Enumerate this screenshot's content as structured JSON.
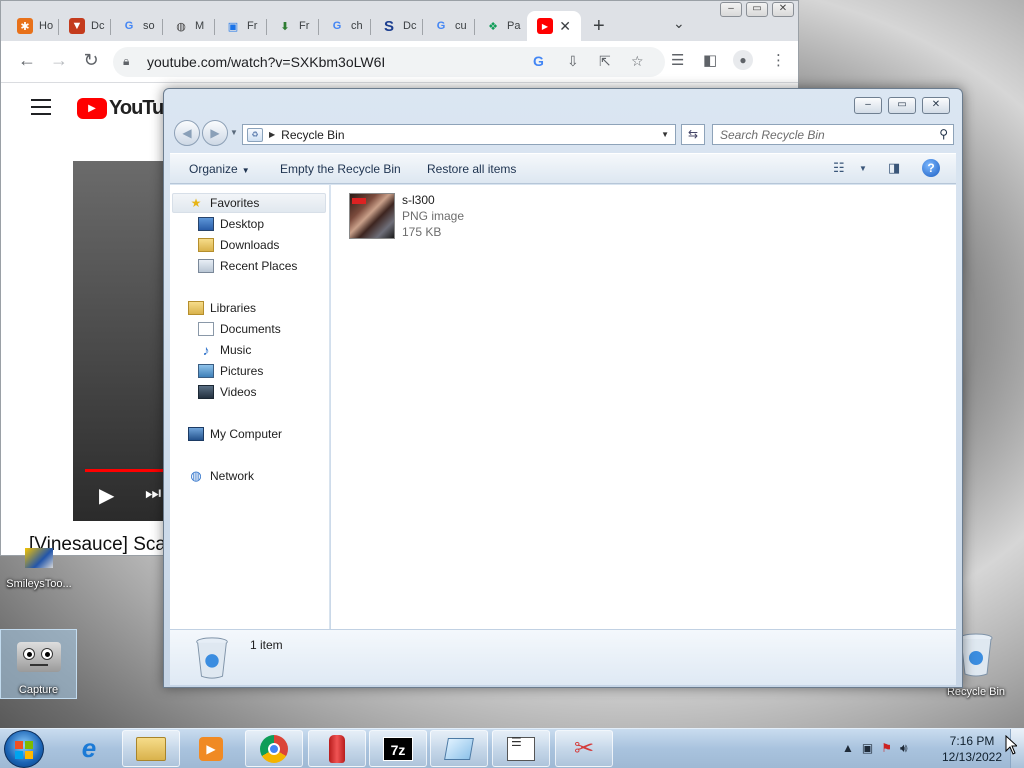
{
  "chrome": {
    "tabs": [
      {
        "label": "Ho",
        "icon": "puzzle-icon",
        "color": "#e8711a"
      },
      {
        "label": "Dc",
        "icon": "shield-icon",
        "color": "#c43b1d"
      },
      {
        "label": "so",
        "icon": "google-icon",
        "color": "#4285f4"
      },
      {
        "label": "M",
        "icon": "globe-icon",
        "color": "#444444"
      },
      {
        "label": "Fr",
        "icon": "document-icon",
        "color": "#1a73e8"
      },
      {
        "label": "Fr",
        "icon": "download-icon",
        "color": "#2e7d32"
      },
      {
        "label": "ch",
        "icon": "google-icon",
        "color": "#4285f4"
      },
      {
        "label": "Dc",
        "icon": "s-icon",
        "color": "#1a3d8f"
      },
      {
        "label": "cu",
        "icon": "google-icon",
        "color": "#4285f4"
      },
      {
        "label": "Pa",
        "icon": "chat-icon",
        "color": "#0f9d58"
      }
    ],
    "active_tab": {
      "icon": "youtube-icon",
      "close": "✕"
    },
    "url": "youtube.com/watch?v=SXKbm3oLW6I",
    "youtube_logo_text": "YouTube",
    "video_title": "[Vinesauce] Scar"
  },
  "explorer": {
    "breadcrumb": "Recycle Bin",
    "search_placeholder": "Search Recycle Bin",
    "commands": {
      "organize": "Organize",
      "empty": "Empty the Recycle Bin",
      "restore": "Restore all items"
    },
    "nav": {
      "favorites": "Favorites",
      "desktop": "Desktop",
      "downloads": "Downloads",
      "recent": "Recent Places",
      "libraries": "Libraries",
      "documents": "Documents",
      "music": "Music",
      "pictures": "Pictures",
      "videos": "Videos",
      "computer": "My Computer",
      "network": "Network"
    },
    "file": {
      "name": "s-l300",
      "type": "PNG image",
      "size": "175 KB"
    },
    "item_count": "1 item"
  },
  "desktop": {
    "smileys_label": "SmileysToo...",
    "capture_label": "Capture",
    "recycle_label": "Recycle Bin"
  },
  "taskbar": {
    "time": "7:16 PM",
    "date": "12/13/2022",
    "apps": [
      "internet-explorer-icon",
      "file-explorer-icon",
      "media-player-icon",
      "chrome-icon",
      "fire-extinguisher-icon",
      "7zip-icon",
      "notepad-icon",
      "notes-list-icon",
      "snipping-tool-icon"
    ]
  }
}
